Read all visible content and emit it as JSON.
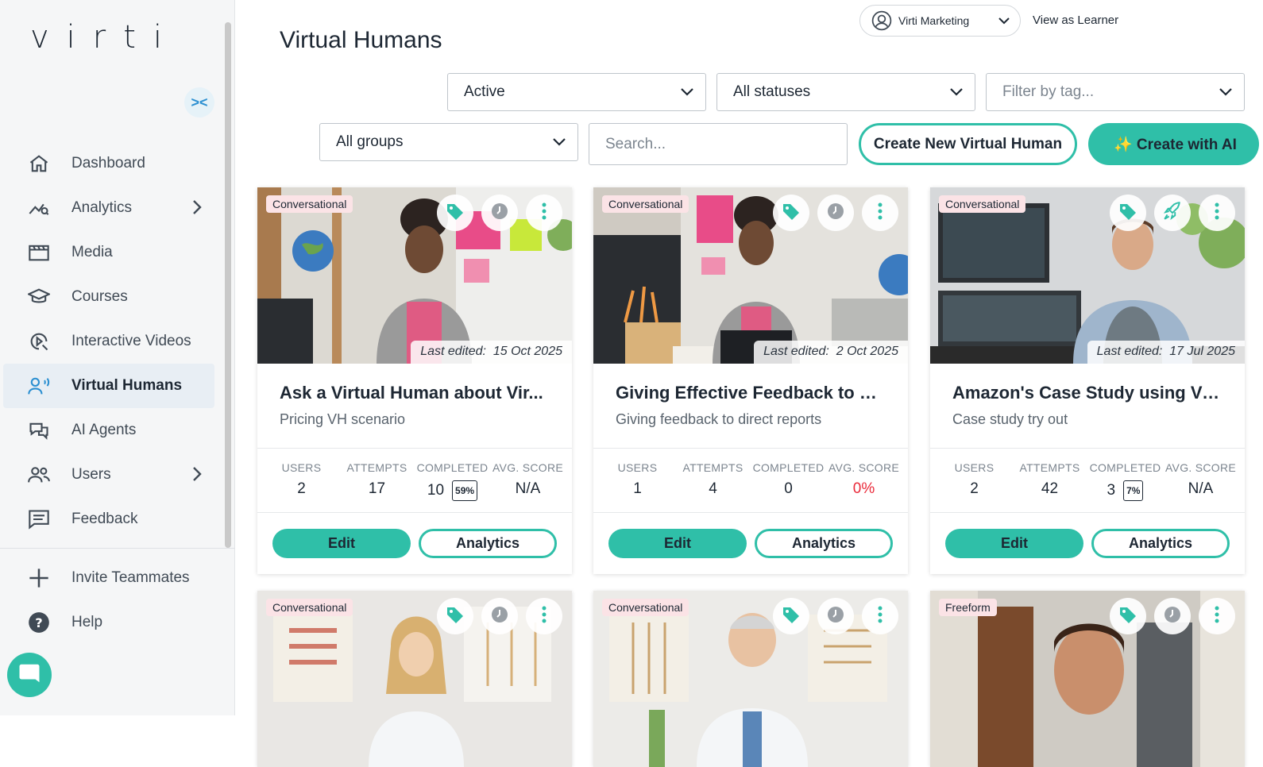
{
  "app": {
    "logo": "virti"
  },
  "sidebar": {
    "items": [
      {
        "label": "Dashboard",
        "icon": "home-icon",
        "has_chevron": false,
        "active": false
      },
      {
        "label": "Analytics",
        "icon": "analytics-icon",
        "has_chevron": true,
        "active": false
      },
      {
        "label": "Media",
        "icon": "media-icon",
        "has_chevron": false,
        "active": false
      },
      {
        "label": "Courses",
        "icon": "courses-icon",
        "has_chevron": false,
        "active": false
      },
      {
        "label": "Interactive Videos",
        "icon": "interactive-video-icon",
        "has_chevron": false,
        "active": false
      },
      {
        "label": "Virtual Humans",
        "icon": "virtual-human-icon",
        "has_chevron": false,
        "active": true
      },
      {
        "label": "AI Agents",
        "icon": "ai-agents-icon",
        "has_chevron": false,
        "active": false
      },
      {
        "label": "Users",
        "icon": "users-icon",
        "has_chevron": true,
        "active": false
      },
      {
        "label": "Feedback",
        "icon": "feedback-icon",
        "has_chevron": false,
        "active": false
      }
    ],
    "bottom_items": [
      {
        "label": "Invite Teammates",
        "icon": "plus-icon"
      },
      {
        "label": "Help",
        "icon": "help-icon"
      }
    ]
  },
  "header": {
    "title": "Virtual Humans",
    "account": "Virti Marketing",
    "view_as_learner": "View as Learner"
  },
  "filters": {
    "active": "Active",
    "status": "All statuses",
    "tag_placeholder": "Filter by tag...",
    "groups": "All groups",
    "search_placeholder": "Search...",
    "create_new": "Create New Virtual Human",
    "create_ai": "✨ Create with AI"
  },
  "stat_labels": {
    "users": "USERS",
    "attempts": "ATTEMPTS",
    "completed": "COMPLETED",
    "avg_score": "AVG. SCORE"
  },
  "card_labels": {
    "edit": "Edit",
    "analytics": "Analytics",
    "last_edited_prefix": "Last edited:"
  },
  "cards": [
    {
      "badge": "Conversational",
      "last_edited": "15 Oct 2025",
      "title": "Ask a Virtual Human about Vir...",
      "subtitle": "Pricing VH scenario",
      "users": "2",
      "attempts": "17",
      "completed": "10",
      "completed_pct": "59%",
      "avg_score": "N/A",
      "status_icon": "clock-icon"
    },
    {
      "badge": "Conversational",
      "last_edited": "2 Oct 2025",
      "title": "Giving Effective Feedback to D...",
      "subtitle": "Giving feedback to direct reports",
      "users": "1",
      "attempts": "4",
      "completed": "0",
      "completed_pct": "",
      "avg_score": "0%",
      "status_icon": "clock-icon"
    },
    {
      "badge": "Conversational",
      "last_edited": "17 Jul 2025",
      "title": "Amazon's Case Study using Virti!",
      "subtitle": "Case study try out",
      "users": "2",
      "attempts": "42",
      "completed": "3",
      "completed_pct": "7%",
      "avg_score": "N/A",
      "status_icon": "rocket-icon"
    },
    {
      "badge": "Conversational",
      "status_icon": "clock-icon"
    },
    {
      "badge": "Conversational",
      "status_icon": "clock-icon"
    },
    {
      "badge": "Freeform",
      "status_icon": "clock-icon"
    }
  ],
  "colors": {
    "accent": "#2fbfa8",
    "danger": "#ea2a3a",
    "badge_bg": "#fbe3e6",
    "active_nav": "#e8eef4"
  }
}
